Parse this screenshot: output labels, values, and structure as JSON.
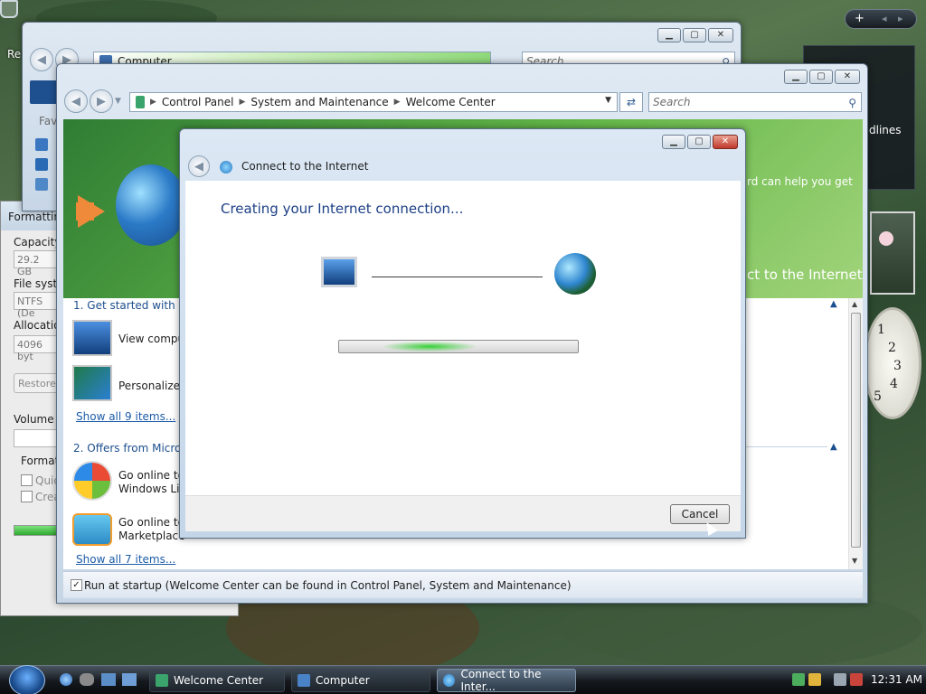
{
  "desktop": {
    "recycle_label": "Re",
    "sidebar_snip": "dlines",
    "clock_numbers": [
      "1",
      "2",
      "3",
      "4",
      "5"
    ]
  },
  "format_window": {
    "title": "Formattin",
    "capacity_label": "Capacity:",
    "capacity_value": "29.2 GB",
    "filesystem_label": "File syster",
    "filesystem_value": "NTFS (De",
    "allocation_label": "Allocation",
    "allocation_value": "4096 byt",
    "restore_label": "Restore",
    "volume_label": "Volume lal",
    "format_options_label": "Format",
    "quick_label": "Quicl",
    "create_label": "Crea"
  },
  "computer_window": {
    "address": "Computer",
    "search_placeholder": "Search",
    "favorites_label": "Favo"
  },
  "welcome_window": {
    "breadcrumb": [
      "Control Panel",
      "System and Maintenance",
      "Welcome Center"
    ],
    "search_placeholder": "Search",
    "banner_text_1": "rd can help you get",
    "banner_text_2": "ct to the Internet",
    "section1_title": "1. Get started with Win",
    "items1": [
      {
        "label": "View comput",
        "icon": "computer-icon"
      },
      {
        "label": "Personalize W",
        "icon": "personalize-icon"
      }
    ],
    "show_all_1": "Show all 9 items...",
    "section2_title": "2. Offers from Microso",
    "items2": [
      {
        "label_1": "Go online to",
        "label_2": "Windows Liv",
        "icon": "windows-live-icon"
      },
      {
        "label_1": "Go online to",
        "label_2": "Marketplace",
        "icon": "marketplace-icon"
      }
    ],
    "show_all_2": "Show all 7 items...",
    "startup_checked": true,
    "startup_text": "Run at startup (Welcome Center can be found in Control Panel, System and Maintenance)"
  },
  "dialog": {
    "title": "Connect to the Internet",
    "heading": "Creating your Internet connection...",
    "cancel_label": "Cancel"
  },
  "taskbar": {
    "buttons": [
      {
        "label": "Welcome Center",
        "active": false
      },
      {
        "label": "Computer",
        "active": false
      },
      {
        "label": "Connect to the Inter...",
        "active": true
      }
    ],
    "clock": "12:31 AM"
  },
  "colors": {
    "accent_link": "#1c5ca8",
    "banner_green": "#2f7d34",
    "progress_green": "#35d135"
  }
}
